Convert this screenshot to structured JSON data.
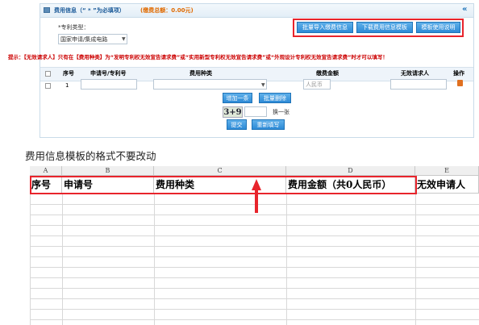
{
  "panel": {
    "title": "费用信息（“ * ”为必填项）",
    "total": "(缴费总额：0.00元)",
    "buttons": {
      "batch_import": "批量导入缴费信息",
      "download_template": "下载费用信息模板",
      "template_help": "模板使用说明"
    },
    "patent_type_label": "*专利类型：",
    "patent_type_value": "国家申请/集成电路",
    "tip": "提示：【无效请求人】只有在【费用种类】为“发明专利权无效宣告请求费”或“实用新型专利权无效宣告请求费”或“外观设计专利权无效宣告请求费”时才可以填写！",
    "table": {
      "headers": [
        "序号",
        "申请号/专利号",
        "费用种类",
        "缴费金额",
        "无效请求人",
        "操作"
      ],
      "row": {
        "index": "1",
        "amount_placeholder": "人民币"
      }
    },
    "add_button": "增加一条",
    "batch_delete_button": "批量删除",
    "captcha": "3+9",
    "refresh_link": "换一张",
    "submit_button": "提交",
    "reset_button": "重新填写"
  },
  "caption": "费用信息模板的格式不要改动",
  "sheet": {
    "columns": [
      "A",
      "B",
      "C",
      "D",
      "E"
    ],
    "headers": [
      "序号",
      "申请号",
      "费用种类",
      "费用金额（共0人民币）",
      "无效申请人"
    ]
  },
  "colors": {
    "annotation_red": "#e8242c",
    "header_blue": "#1e5c9a",
    "tip_red": "#cc0000",
    "total_orange": "#e06a00"
  }
}
